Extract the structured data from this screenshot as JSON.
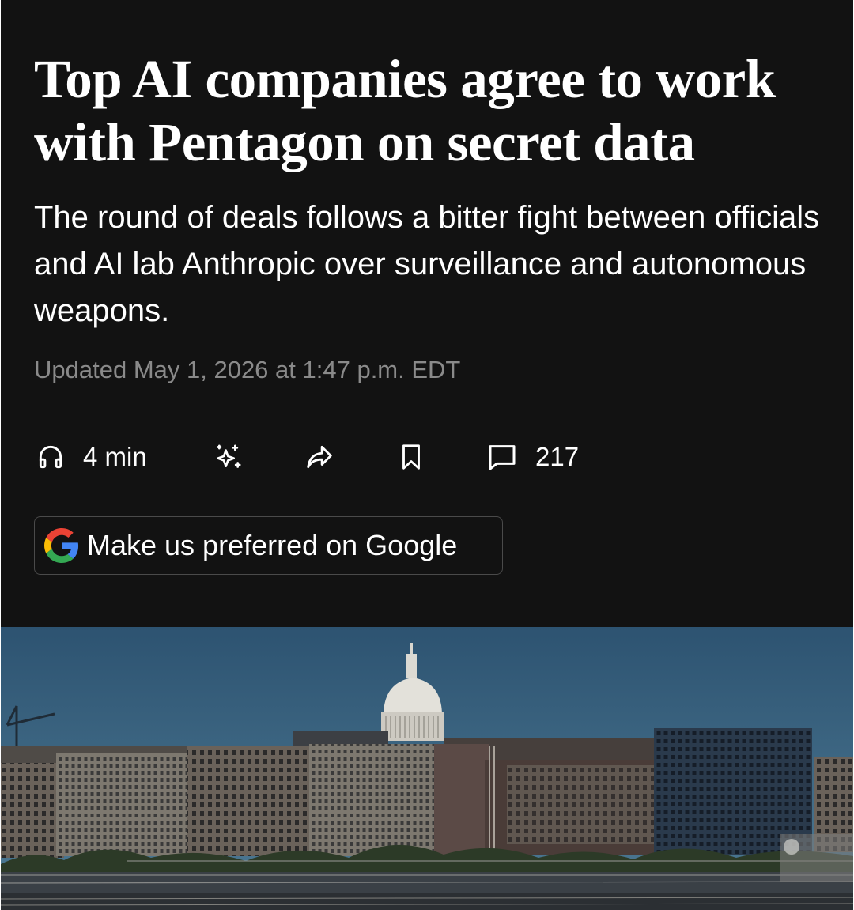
{
  "article": {
    "headline": "Top AI companies agree to work with Pentagon on secret data",
    "dek": "The round of deals follows a bitter fight between officials and AI lab Anthropic over surveillance and autonomous weapons.",
    "timestamp": "Updated May 1, 2026 at 1:47 p.m. EDT"
  },
  "actions": {
    "listen": {
      "icon": "headphones-icon",
      "label": "4 min"
    },
    "summarize": {
      "icon": "sparkle-icon"
    },
    "share": {
      "icon": "share-arrow-icon"
    },
    "save": {
      "icon": "bookmark-icon"
    },
    "comments": {
      "icon": "comment-icon",
      "count": "217"
    }
  },
  "google_button": {
    "icon": "google-g-icon",
    "label": "Make us preferred on Google"
  },
  "hero_image": {
    "subject": "capitol-dome-skyline-photo"
  },
  "colors": {
    "background": "#121212",
    "text": "#ffffff",
    "muted": "#8a8a8a",
    "button_border": "#4a4a4a"
  }
}
